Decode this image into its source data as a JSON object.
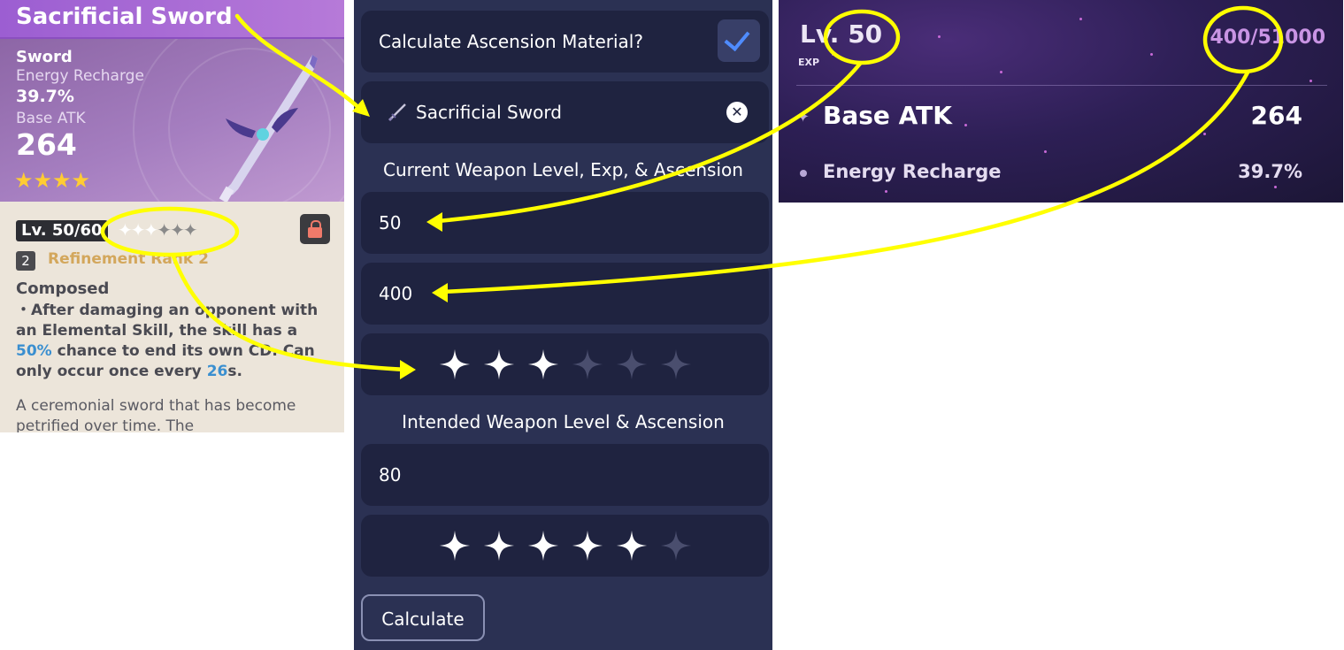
{
  "weapon_card": {
    "name": "Sacrificial Sword",
    "type": "Sword",
    "substat_label": "Energy Recharge",
    "substat_value": "39.7%",
    "base_atk_label": "Base ATK",
    "base_atk_value": "264",
    "rarity_stars": "★★★★",
    "level": "Lv. 50/60",
    "ascension": {
      "filled": 3,
      "total": 6
    },
    "refinement_number": "2",
    "refinement_text": "Refinement Rank 2",
    "passive_name": "Composed",
    "passive_desc_1": "・After damaging an opponent with an Elemental Skill, the skill has a ",
    "passive_chance": "50%",
    "passive_desc_2": " chance to end its own CD. Can only occur once every ",
    "passive_cd": "26",
    "passive_desc_3": "s.",
    "lore": "A ceremonial sword that has become petrified over time. The"
  },
  "calculator": {
    "ascension_toggle_label": "Calculate Ascension Material?",
    "ascension_toggle_checked": true,
    "selected_weapon": "Sacrificial Sword",
    "current_section_label": "Current Weapon Level, Exp, & Ascension",
    "current_level": "50",
    "current_exp": "400",
    "current_ascension": 3,
    "intended_section_label": "Intended Weapon Level & Ascension",
    "intended_level": "80",
    "intended_ascension": 5,
    "max_ascension": 6,
    "calculate_button": "Calculate"
  },
  "ingame_stats": {
    "level": "Lv. 50",
    "exp_label": "EXP",
    "exp_value": "400/51000",
    "main_stat_label": "Base ATK",
    "main_stat_value": "264",
    "sub_stat_label": "Energy Recharge",
    "sub_stat_value": "39.7%"
  },
  "annotation_color": "#ffff00",
  "icons": [
    "lock-icon",
    "sword-icon",
    "close-icon",
    "check-icon",
    "star-icon"
  ]
}
